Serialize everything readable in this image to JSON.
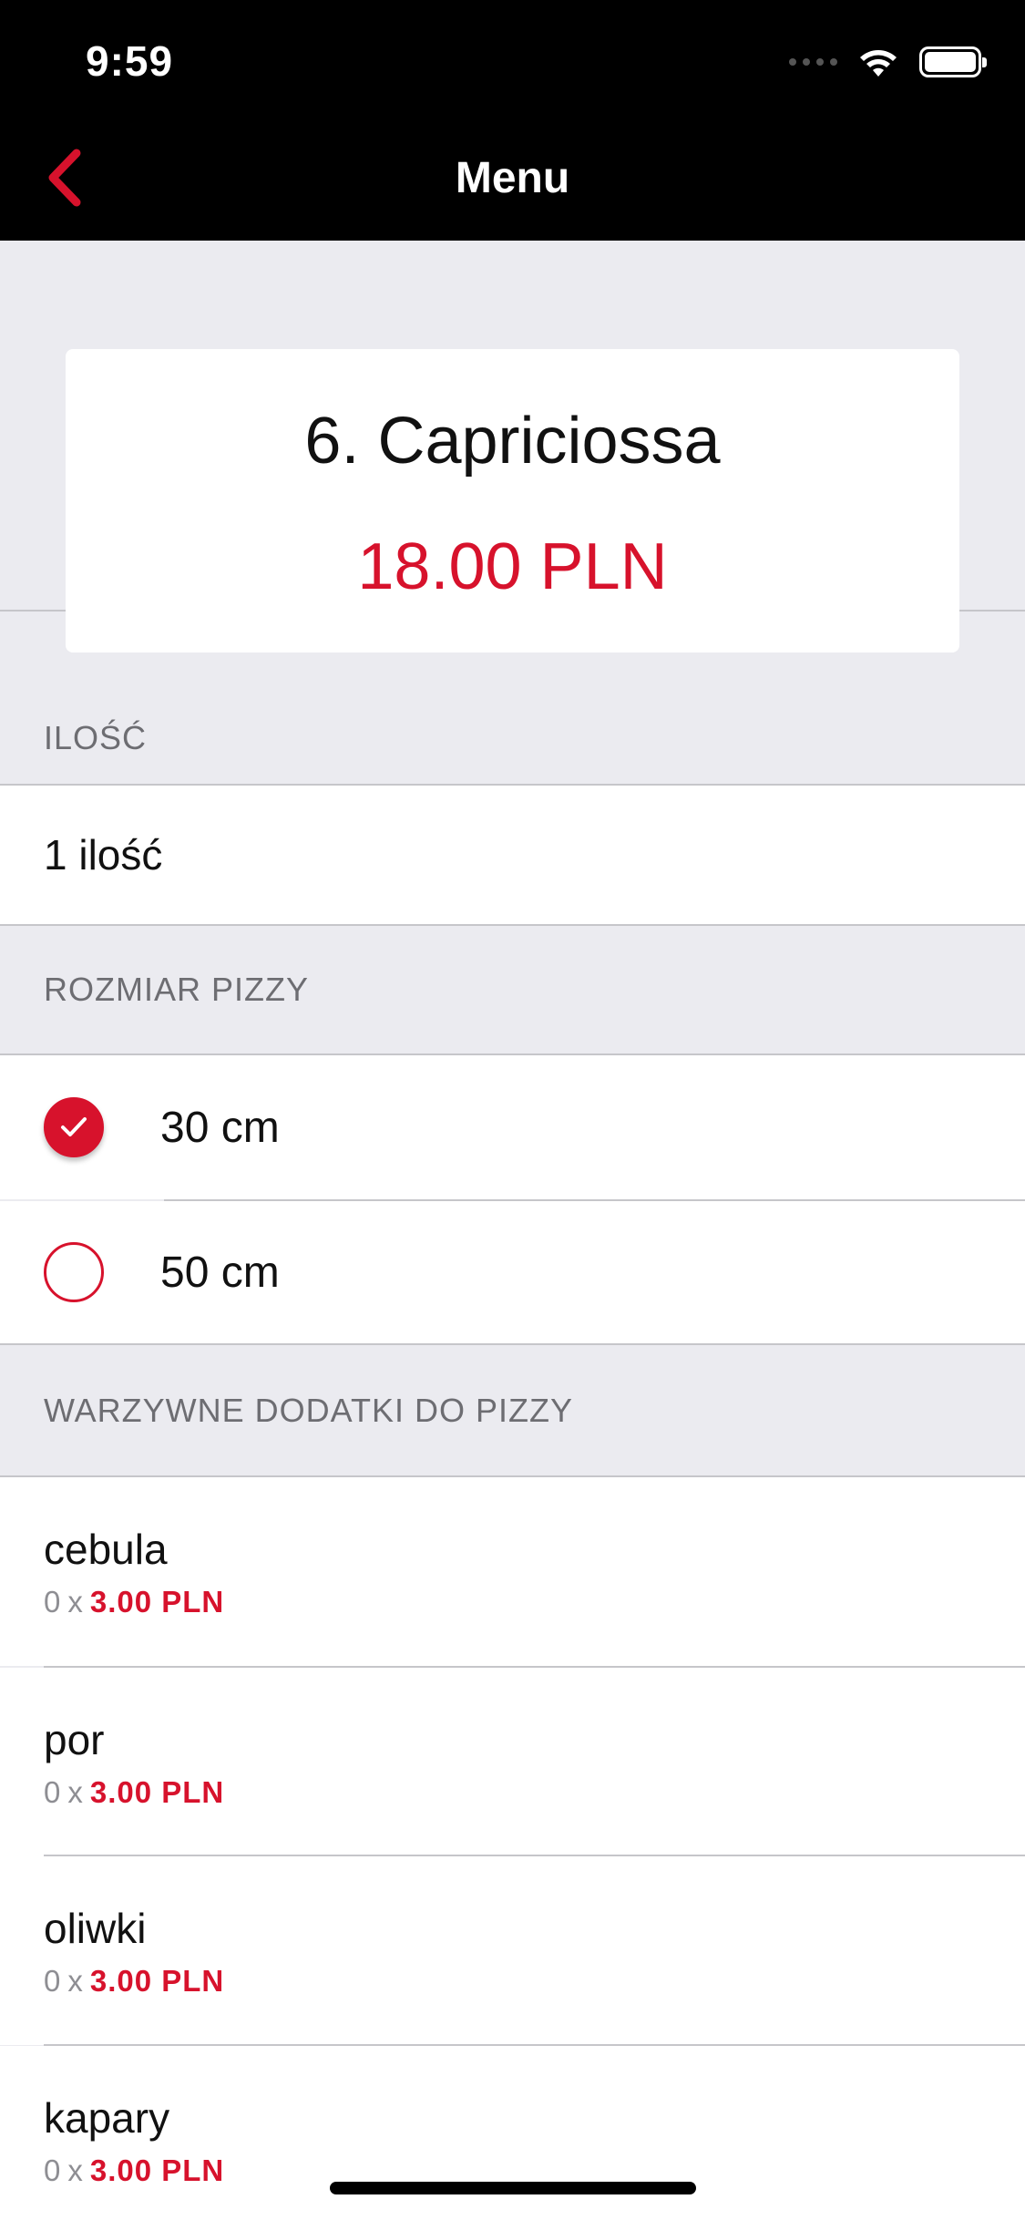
{
  "status_bar": {
    "time": "9:59"
  },
  "nav": {
    "title": "Menu",
    "back_icon": "chevron-left-icon"
  },
  "product": {
    "name": "6. Capriciossa",
    "price": "18.00 PLN"
  },
  "quantity_section": {
    "header": "ILOŚĆ",
    "value": "1 ilość"
  },
  "size_section": {
    "header": "ROZMIAR PIZZY",
    "options": [
      {
        "label": "30 cm",
        "selected": true
      },
      {
        "label": "50 cm",
        "selected": false
      }
    ]
  },
  "addons_section": {
    "header": "WARZYWNE DODATKI DO PIZZY",
    "items": [
      {
        "name": "cebula",
        "count": "0",
        "times": "x",
        "price": "3.00 PLN"
      },
      {
        "name": "por",
        "count": "0",
        "times": "x",
        "price": "3.00 PLN"
      },
      {
        "name": "oliwki",
        "count": "0",
        "times": "x",
        "price": "3.00 PLN"
      },
      {
        "name": "kapary",
        "count": "0",
        "times": "x",
        "price": "3.00 PLN"
      }
    ]
  },
  "colors": {
    "accent": "#d7122c",
    "background": "#ebebf0",
    "header_text": "#6d6d72"
  }
}
